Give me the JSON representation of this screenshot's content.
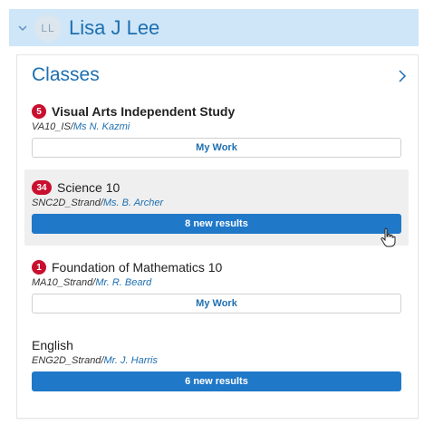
{
  "header": {
    "avatar_initials": "LL",
    "student_name": "Lisa J Lee",
    "background": "#cfe6f8"
  },
  "panel": {
    "title": "Classes"
  },
  "classes": [
    {
      "badge": "5",
      "name": "Visual Arts Independent Study",
      "code": "VA10_IS",
      "teacher": "Ms N. Kazmi",
      "button_label": "My Work",
      "button_style": "outline"
    },
    {
      "badge": "34",
      "name": "Science 10",
      "code": "SNC2D_Strand",
      "teacher": "Ms. B. Archer",
      "button_label": "8 new results",
      "button_style": "solid"
    },
    {
      "badge": "1",
      "name": "Foundation of Mathematics 10",
      "code": "MA10_Strand",
      "teacher": "Mr. R. Beard",
      "button_label": "My Work",
      "button_style": "outline"
    },
    {
      "badge": "",
      "name": "English",
      "code": "ENG2D_Strand",
      "teacher": "Mr. J. Harris",
      "button_label": "6 new results",
      "button_style": "solid"
    }
  ],
  "colors": {
    "accent": "#1e6fb0",
    "badge": "#c8102e",
    "button_solid": "#1f78c8",
    "highlight_row": "#efefef"
  },
  "icons": {
    "collapse": "chevron-down-icon",
    "navigate": "chevron-right-icon",
    "pointer": "hand-cursor-icon"
  }
}
